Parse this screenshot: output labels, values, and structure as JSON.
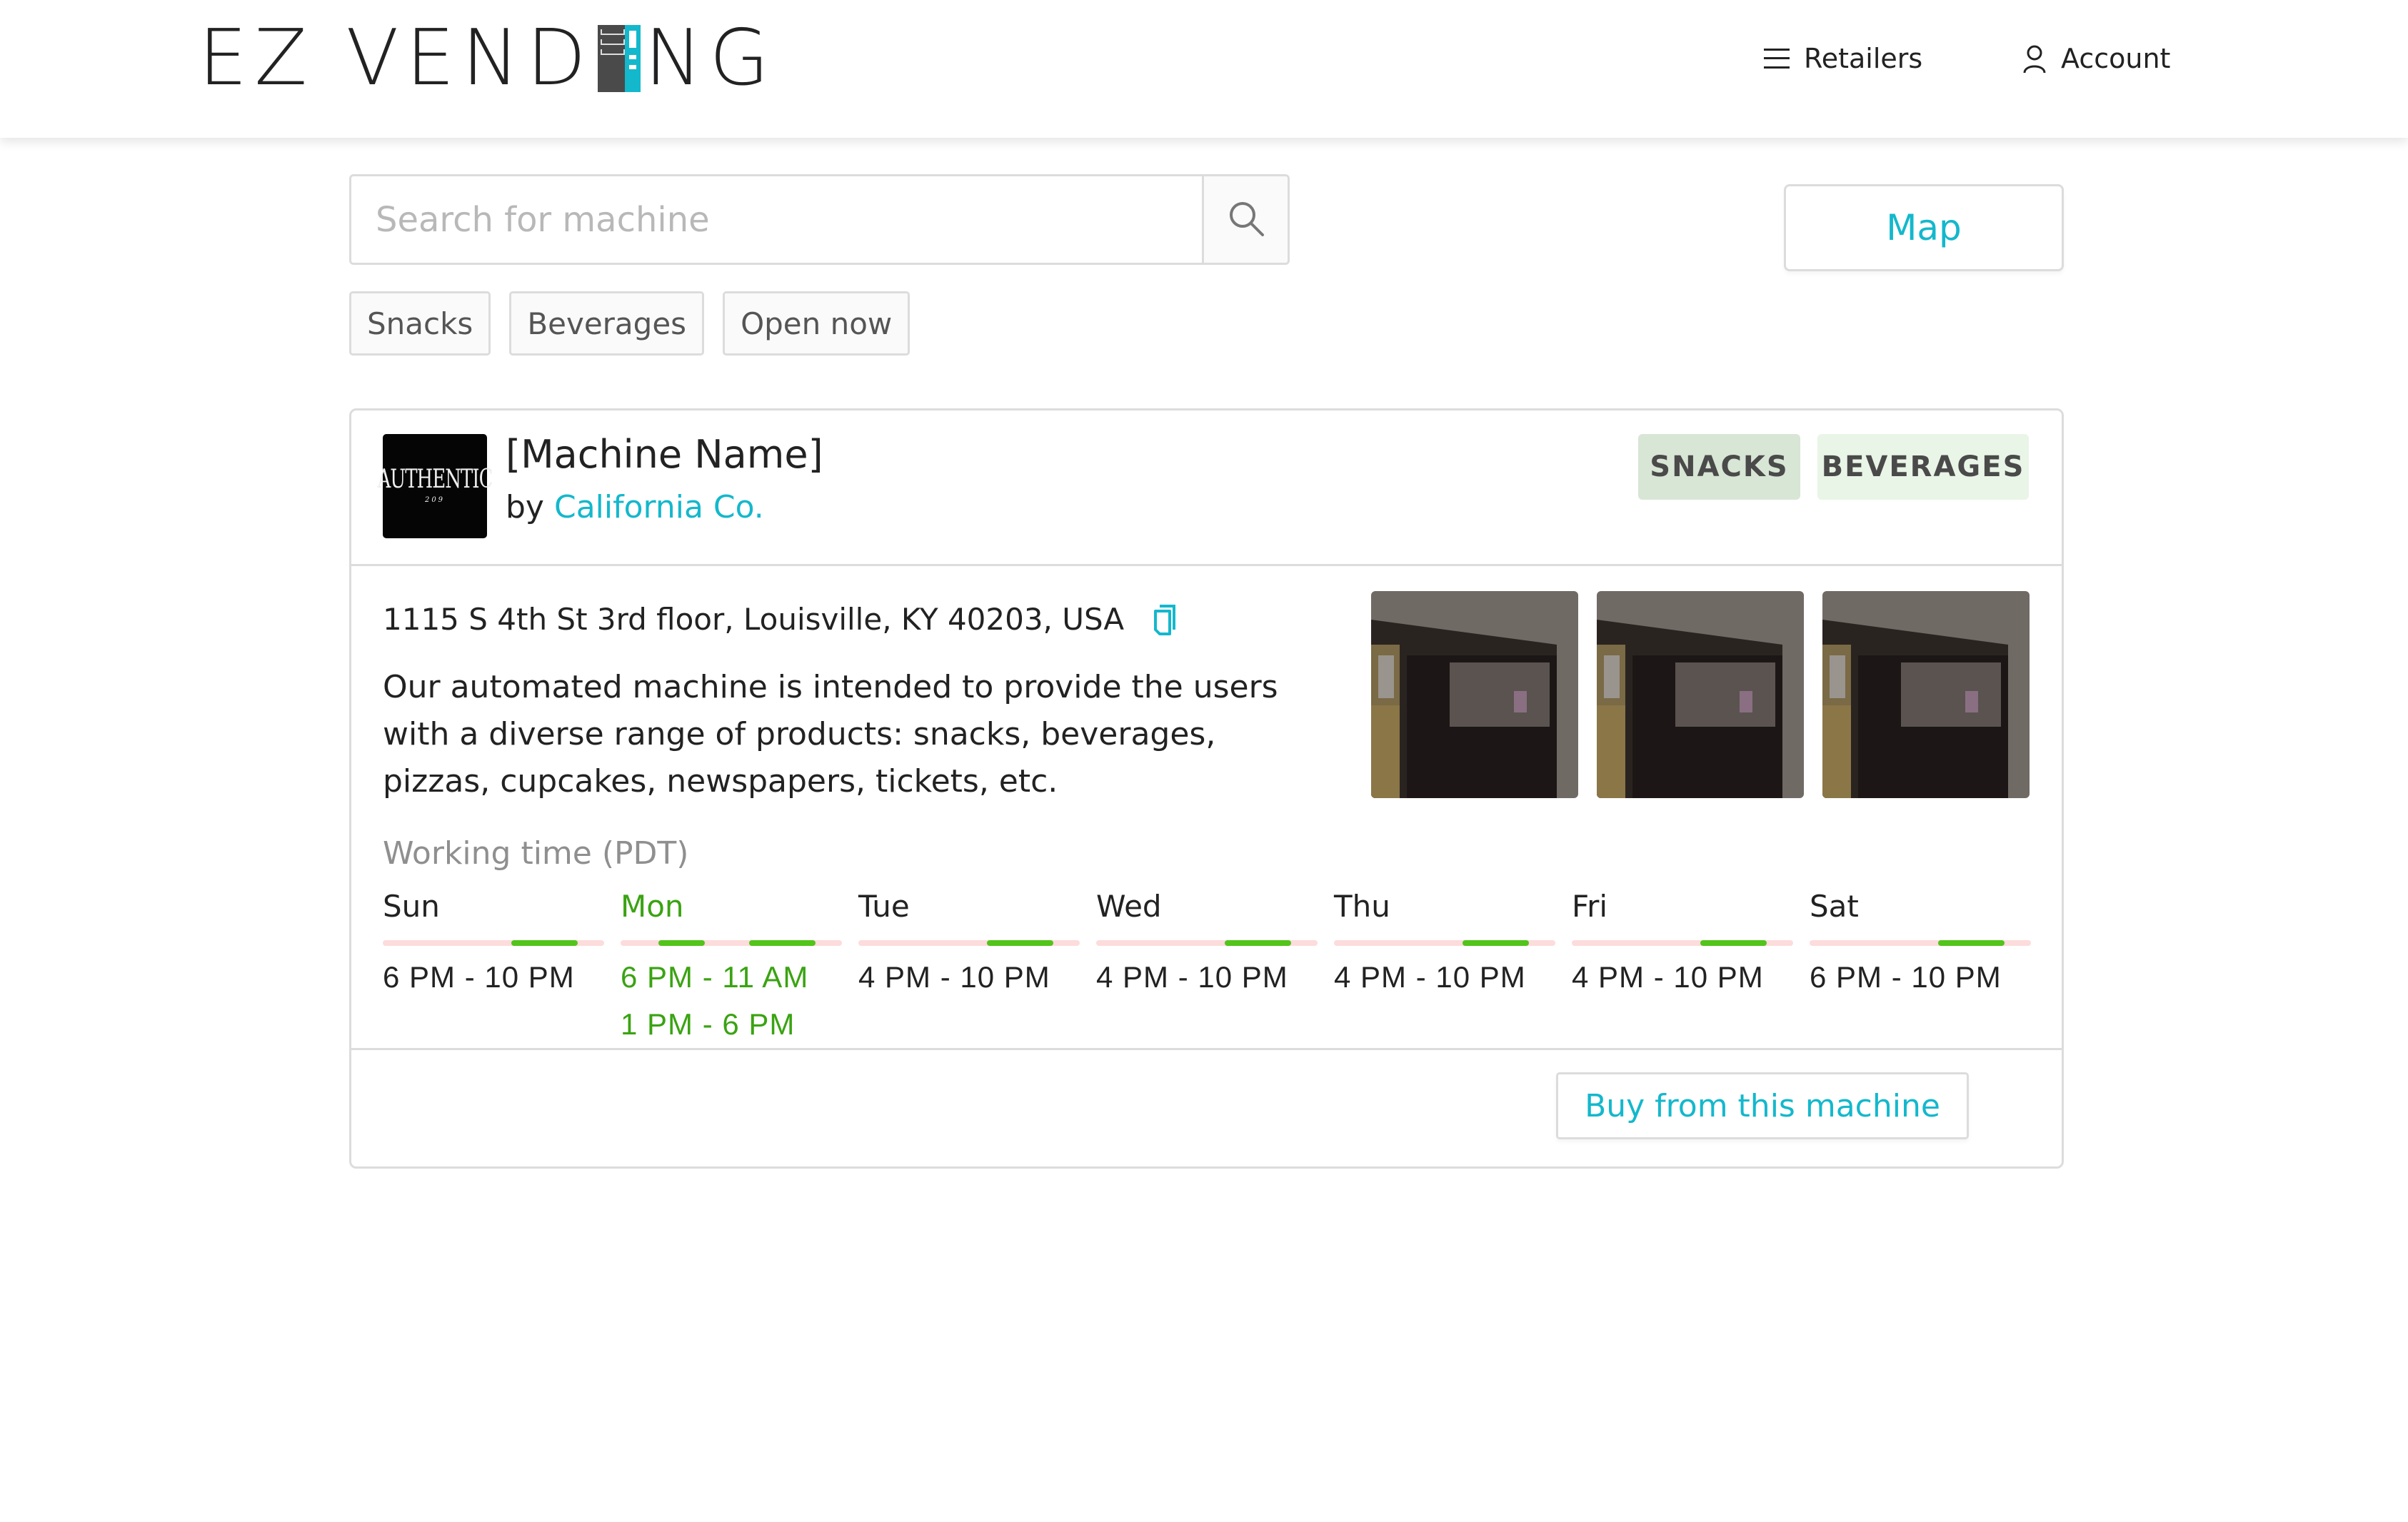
{
  "header": {
    "logo_text_left": "EZ VEND",
    "logo_text_right": "NG",
    "nav": [
      {
        "label": "Retailers",
        "icon": "menu-icon"
      },
      {
        "label": "Account",
        "icon": "user-icon"
      }
    ]
  },
  "search": {
    "placeholder": "Search for machine",
    "value": "",
    "button_icon": "search-icon"
  },
  "map_button": {
    "label": "Map"
  },
  "filters": [
    {
      "label": "Snacks"
    },
    {
      "label": "Beverages"
    },
    {
      "label": "Open now"
    }
  ],
  "machine": {
    "brand_logo": {
      "line1": "AUTHENTIC",
      "line2": "209"
    },
    "name": "[Machine Name]",
    "by_prefix": "by",
    "owner": "California Co.",
    "tags": [
      "SNACKS",
      "BEVERAGES"
    ],
    "address": "1115 S 4th St 3rd floor, Louisville, KY 40203, USA",
    "description": "Our automated machine is intended to provide the users with a diverse range of products: snacks, beverages, pizzas, cupcakes, newspapers, tickets, etc.",
    "photos_count": 3,
    "working_time_label": "Working time (PDT)",
    "schedule": [
      {
        "day": "Sun",
        "today": false,
        "times": [
          "6 PM - 10 PM"
        ],
        "open_fractions": [
          [
            0.58,
            0.88
          ]
        ]
      },
      {
        "day": "Mon",
        "today": true,
        "times": [
          "6 PM - 11 AM",
          "1 PM - 6 PM"
        ],
        "open_fractions": [
          [
            0.17,
            0.38
          ],
          [
            0.58,
            0.88
          ]
        ]
      },
      {
        "day": "Tue",
        "today": false,
        "times": [
          "4 PM - 10 PM"
        ],
        "open_fractions": [
          [
            0.58,
            0.88
          ]
        ]
      },
      {
        "day": "Wed",
        "today": false,
        "times": [
          "4 PM - 10 PM"
        ],
        "open_fractions": [
          [
            0.58,
            0.88
          ]
        ]
      },
      {
        "day": "Thu",
        "today": false,
        "times": [
          "4 PM - 10 PM"
        ],
        "open_fractions": [
          [
            0.58,
            0.88
          ]
        ]
      },
      {
        "day": "Fri",
        "today": false,
        "times": [
          "4 PM - 10 PM"
        ],
        "open_fractions": [
          [
            0.58,
            0.88
          ]
        ]
      },
      {
        "day": "Sat",
        "today": false,
        "times": [
          "6 PM - 10 PM"
        ],
        "open_fractions": [
          [
            0.58,
            0.88
          ]
        ]
      }
    ],
    "buy_button": "Buy from this machine"
  },
  "colors": {
    "accent": "#14b8cc",
    "open": "#52c41a",
    "closed": "#fddcdc",
    "today": "#3aa312",
    "tag_snacks_bg": "#d8e6d5",
    "tag_beverages_bg": "#e9f5e6"
  }
}
